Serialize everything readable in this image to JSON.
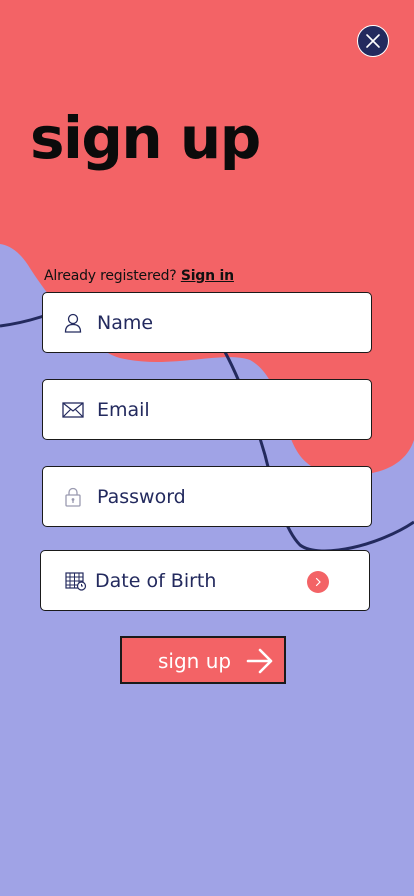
{
  "title": "sign up",
  "already_text": "Already registered?",
  "sign_in_link": "Sign in",
  "fields": {
    "name_placeholder": "Name",
    "email_placeholder": "Email",
    "password_placeholder": "Password",
    "dob_placeholder": "Date of Birth"
  },
  "submit_label": "sign up",
  "icons": {
    "close": "close-icon",
    "name": "user-icon",
    "email": "envelope-icon",
    "password": "lock-icon",
    "dob": "calendar-icon",
    "dob_action": "chevron-right-icon",
    "submit": "arrow-right-icon"
  },
  "colors": {
    "background": "#a0a3e6",
    "coral": "#f36366",
    "navy": "#232a5e",
    "field_bg": "#ffffff"
  }
}
